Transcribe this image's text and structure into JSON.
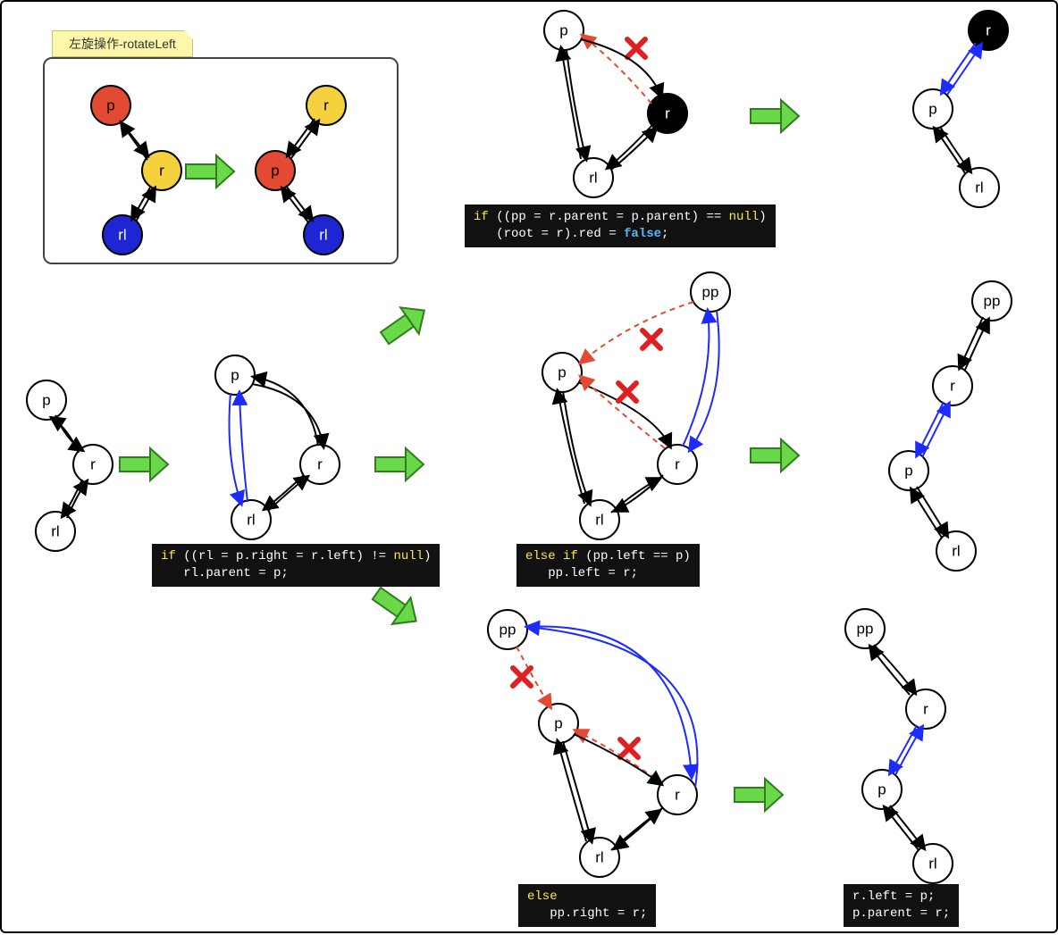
{
  "title_note": "左旋操作-rotateLeft",
  "labels": {
    "p": "p",
    "r": "r",
    "rl": "rl",
    "pp": "pp"
  },
  "colors": {
    "red": "#e34a33",
    "yellow": "#f4d13d",
    "blue": "#1d26d2",
    "black": "#000",
    "white": "#fff",
    "arrowGreen": "#69d94a",
    "arrowGreenEdge": "#2f7d1c",
    "linkBlue": "#1d2bff",
    "linkRed": "#e34a33"
  },
  "code_box1": {
    "l1": "if ((pp = r.parent = p.parent) == null)",
    "l2": "   (root = r).red = false;"
  },
  "code_box2": {
    "l1": "if ((rl = p.right = r.left) != null)",
    "l2": "   rl.parent = p;"
  },
  "code_box3": {
    "l1": "else if (pp.left == p)",
    "l2": "   pp.left = r;"
  },
  "code_box4": {
    "l1": "else",
    "l2": "   pp.right = r;"
  },
  "code_box5": {
    "l1": "r.left = p;",
    "l2": "p.parent = r;"
  },
  "watermark": ""
}
